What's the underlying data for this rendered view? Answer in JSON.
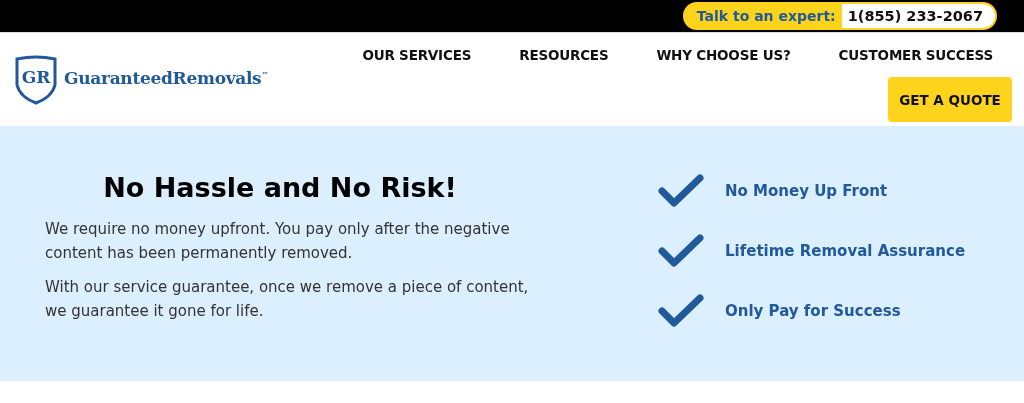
{
  "top_bar": {
    "label": "Talk to an expert:",
    "phone": "1(855) 233-2067"
  },
  "header": {
    "logo": {
      "monogram": "GR",
      "name": "GuaranteedRemovals",
      "mark": "™"
    },
    "nav": [
      {
        "label": "OUR SERVICES"
      },
      {
        "label": "RESOURCES"
      },
      {
        "label": "WHY CHOOSE US?"
      },
      {
        "label": "CUSTOMER SUCCESS"
      }
    ],
    "cta": "GET A QUOTE"
  },
  "hero": {
    "title": "No Hassle and No Risk!",
    "paragraphs": [
      "We require no money upfront. You pay only after the negative content has been permanently removed.",
      "With our service guarantee, once we remove a piece of content, we guarantee it gone for life."
    ],
    "benefits": [
      {
        "label": "No Money Up Front"
      },
      {
        "label": "Lifetime Removal Assurance"
      },
      {
        "label": "Only Pay for Success"
      }
    ]
  }
}
